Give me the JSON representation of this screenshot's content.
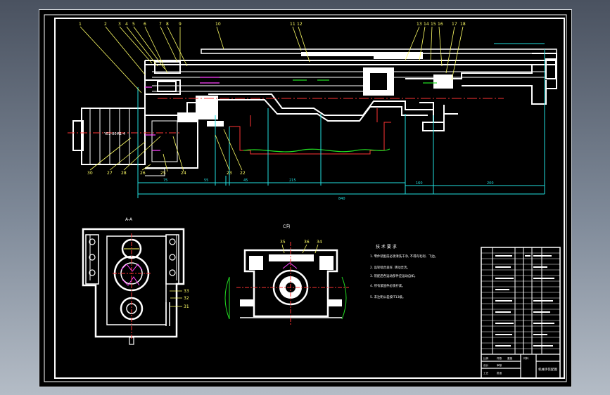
{
  "drawing": {
    "section_views": {
      "section_a": "A-A",
      "section_c": "C向"
    },
    "callouts_top": [
      "1",
      "2",
      "3",
      "4",
      "5",
      "6",
      "7",
      "8",
      "9",
      "10",
      "11",
      "12",
      "13",
      "14",
      "15",
      "16",
      "17",
      "18"
    ],
    "callouts_bottom": [
      "30",
      "27",
      "28",
      "26",
      "25",
      "24",
      "23",
      "22"
    ],
    "callouts_aa": [
      "33",
      "32",
      "31"
    ],
    "callouts_c": [
      "35",
      "36",
      "34"
    ],
    "dimensions": {
      "overall": "840",
      "segment_1": "75",
      "segment_2": "55",
      "segment_3": "45",
      "segment_4": "215",
      "segment_5": "160",
      "right_block": "200",
      "motor_label": "YE2-80M1-4"
    },
    "tech_notes": {
      "title": "技 术 要 求",
      "items": [
        "1. 零件装配前必须清洗干净, 不得有毛刺、飞边。",
        "2. 齿轮啮合良好, 转动灵活。",
        "3. 装配后各运动部件应运动自如。",
        "4. 所有紧固件必须拧紧。",
        "5. 未注明公差按IT13级。"
      ]
    },
    "title_block": {
      "title": "机械手装配图",
      "rows": [
        "比例",
        "件数",
        "重量",
        "材料",
        "设计",
        "审核",
        "工艺",
        "批准"
      ]
    }
  },
  "colors": {
    "background": "#000000",
    "outline": "#ffffff",
    "leader": "#ffff66",
    "centerline": "#ff3333",
    "dimension": "#22e0e0",
    "spring": "#22dd22",
    "section_hatch": "#ff44ff"
  }
}
